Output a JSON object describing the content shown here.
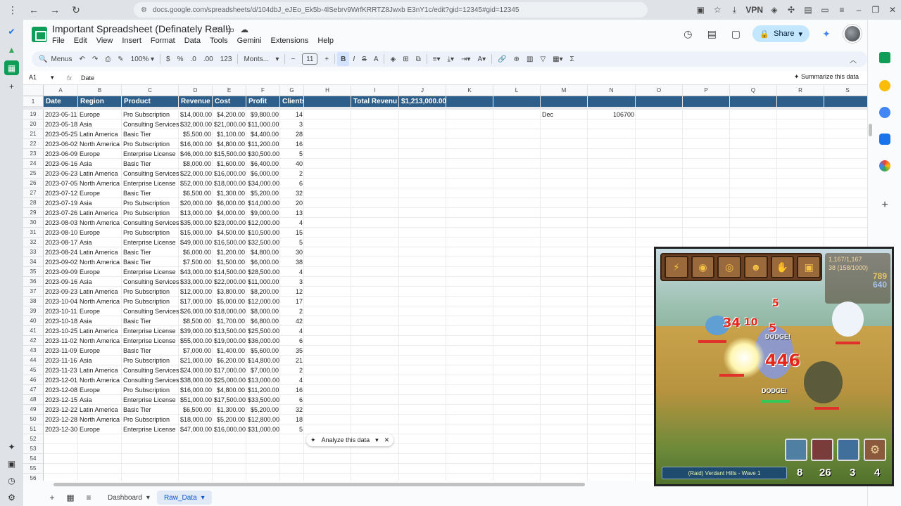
{
  "browser": {
    "url": "docs.google.com/spreadsheets/d/104dbJ_eJEo_Ek5b-4lSebrv9WrfKRRTZ8Jwxb E3nY1c/edit?gid=12345#gid=12345",
    "vpn_label": "VPN"
  },
  "doc": {
    "title": "Important Spreadsheet (Definately Real!)",
    "menus": [
      "File",
      "Edit",
      "View",
      "Insert",
      "Format",
      "Data",
      "Tools",
      "Gemini",
      "Extensions",
      "Help"
    ],
    "share_label": "Share"
  },
  "toolbar": {
    "menus_label": "Menus",
    "zoom": "100%",
    "currency": "$",
    "percent": "%",
    "dec_less": ".0",
    "dec_more": ".00",
    "number_fmt": "123",
    "font": "Monts...",
    "font_size": "11",
    "bold": "B",
    "italic": "I",
    "strike": "S",
    "text_color": "A"
  },
  "formula_bar": {
    "cell_ref": "A1",
    "fx": "fx",
    "value": "Date",
    "summarize_label": "Summarize this data"
  },
  "columns": [
    "A",
    "B",
    "C",
    "D",
    "E",
    "F",
    "G",
    "H",
    "I",
    "J",
    "K",
    "L",
    "M",
    "N",
    "O",
    "P",
    "Q",
    "R",
    "S"
  ],
  "header_row": {
    "row_number": "1",
    "cells": [
      "Date",
      "Region",
      "Product",
      "Revenue",
      "Cost",
      "Profit",
      "Clients"
    ],
    "total_label": "Total Revenu",
    "total_value": "$1,213,000.00"
  },
  "rows": [
    {
      "n": "19",
      "date": "2023-05-11",
      "region": "Europe",
      "product": "Pro Subscription",
      "revenue": "$14,000.00",
      "cost": "$4,200.00",
      "profit": "$9,800.00",
      "clients": "14",
      "m": "Dec",
      "nval": "106700"
    },
    {
      "n": "20",
      "date": "2023-05-18",
      "region": "Asia",
      "product": "Consulting Services",
      "revenue": "$32,000.00",
      "cost": "$21,000.00",
      "profit": "$11,000.00",
      "clients": "3"
    },
    {
      "n": "21",
      "date": "2023-05-25",
      "region": "Latin America",
      "product": "Basic Tier",
      "revenue": "$5,500.00",
      "cost": "$1,100.00",
      "profit": "$4,400.00",
      "clients": "28"
    },
    {
      "n": "22",
      "date": "2023-06-02",
      "region": "North America",
      "product": "Pro Subscription",
      "revenue": "$16,000.00",
      "cost": "$4,800.00",
      "profit": "$11,200.00",
      "clients": "16"
    },
    {
      "n": "23",
      "date": "2023-06-09",
      "region": "Europe",
      "product": "Enterprise License",
      "revenue": "$46,000.00",
      "cost": "$15,500.00",
      "profit": "$30,500.00",
      "clients": "5"
    },
    {
      "n": "24",
      "date": "2023-06-16",
      "region": "Asia",
      "product": "Basic Tier",
      "revenue": "$8,000.00",
      "cost": "$1,600.00",
      "profit": "$6,400.00",
      "clients": "40"
    },
    {
      "n": "25",
      "date": "2023-06-23",
      "region": "Latin America",
      "product": "Consulting Services",
      "revenue": "$22,000.00",
      "cost": "$16,000.00",
      "profit": "$6,000.00",
      "clients": "2"
    },
    {
      "n": "26",
      "date": "2023-07-05",
      "region": "North America",
      "product": "Enterprise License",
      "revenue": "$52,000.00",
      "cost": "$18,000.00",
      "profit": "$34,000.00",
      "clients": "6"
    },
    {
      "n": "27",
      "date": "2023-07-12",
      "region": "Europe",
      "product": "Basic Tier",
      "revenue": "$6,500.00",
      "cost": "$1,300.00",
      "profit": "$5,200.00",
      "clients": "32"
    },
    {
      "n": "28",
      "date": "2023-07-19",
      "region": "Asia",
      "product": "Pro Subscription",
      "revenue": "$20,000.00",
      "cost": "$6,000.00",
      "profit": "$14,000.00",
      "clients": "20"
    },
    {
      "n": "29",
      "date": "2023-07-26",
      "region": "Latin America",
      "product": "Pro Subscription",
      "revenue": "$13,000.00",
      "cost": "$4,000.00",
      "profit": "$9,000.00",
      "clients": "13"
    },
    {
      "n": "30",
      "date": "2023-08-03",
      "region": "North America",
      "product": "Consulting Services",
      "revenue": "$35,000.00",
      "cost": "$23,000.00",
      "profit": "$12,000.00",
      "clients": "4"
    },
    {
      "n": "31",
      "date": "2023-08-10",
      "region": "Europe",
      "product": "Pro Subscription",
      "revenue": "$15,000.00",
      "cost": "$4,500.00",
      "profit": "$10,500.00",
      "clients": "15"
    },
    {
      "n": "32",
      "date": "2023-08-17",
      "region": "Asia",
      "product": "Enterprise License",
      "revenue": "$49,000.00",
      "cost": "$16,500.00",
      "profit": "$32,500.00",
      "clients": "5"
    },
    {
      "n": "33",
      "date": "2023-08-24",
      "region": "Latin America",
      "product": "Basic Tier",
      "revenue": "$6,000.00",
      "cost": "$1,200.00",
      "profit": "$4,800.00",
      "clients": "30"
    },
    {
      "n": "34",
      "date": "2023-09-02",
      "region": "North America",
      "product": "Basic Tier",
      "revenue": "$7,500.00",
      "cost": "$1,500.00",
      "profit": "$6,000.00",
      "clients": "38"
    },
    {
      "n": "35",
      "date": "2023-09-09",
      "region": "Europe",
      "product": "Enterprise License",
      "revenue": "$43,000.00",
      "cost": "$14,500.00",
      "profit": "$28,500.00",
      "clients": "4"
    },
    {
      "n": "36",
      "date": "2023-09-16",
      "region": "Asia",
      "product": "Consulting Services",
      "revenue": "$33,000.00",
      "cost": "$22,000.00",
      "profit": "$11,000.00",
      "clients": "3"
    },
    {
      "n": "37",
      "date": "2023-09-23",
      "region": "Latin America",
      "product": "Pro Subscription",
      "revenue": "$12,000.00",
      "cost": "$3,800.00",
      "profit": "$8,200.00",
      "clients": "12"
    },
    {
      "n": "38",
      "date": "2023-10-04",
      "region": "North America",
      "product": "Pro Subscription",
      "revenue": "$17,000.00",
      "cost": "$5,000.00",
      "profit": "$12,000.00",
      "clients": "17"
    },
    {
      "n": "39",
      "date": "2023-10-11",
      "region": "Europe",
      "product": "Consulting Services",
      "revenue": "$26,000.00",
      "cost": "$18,000.00",
      "profit": "$8,000.00",
      "clients": "2"
    },
    {
      "n": "40",
      "date": "2023-10-18",
      "region": "Asia",
      "product": "Basic Tier",
      "revenue": "$8,500.00",
      "cost": "$1,700.00",
      "profit": "$6,800.00",
      "clients": "42"
    },
    {
      "n": "41",
      "date": "2023-10-25",
      "region": "Latin America",
      "product": "Enterprise License",
      "revenue": "$39,000.00",
      "cost": "$13,500.00",
      "profit": "$25,500.00",
      "clients": "4"
    },
    {
      "n": "42",
      "date": "2023-11-02",
      "region": "North America",
      "product": "Enterprise License",
      "revenue": "$55,000.00",
      "cost": "$19,000.00",
      "profit": "$36,000.00",
      "clients": "6"
    },
    {
      "n": "43",
      "date": "2023-11-09",
      "region": "Europe",
      "product": "Basic Tier",
      "revenue": "$7,000.00",
      "cost": "$1,400.00",
      "profit": "$5,600.00",
      "clients": "35"
    },
    {
      "n": "44",
      "date": "2023-11-16",
      "region": "Asia",
      "product": "Pro Subscription",
      "revenue": "$21,000.00",
      "cost": "$6,200.00",
      "profit": "$14,800.00",
      "clients": "21"
    },
    {
      "n": "45",
      "date": "2023-11-23",
      "region": "Latin America",
      "product": "Consulting Services",
      "revenue": "$24,000.00",
      "cost": "$17,000.00",
      "profit": "$7,000.00",
      "clients": "2"
    },
    {
      "n": "46",
      "date": "2023-12-01",
      "region": "North America",
      "product": "Consulting Services",
      "revenue": "$38,000.00",
      "cost": "$25,000.00",
      "profit": "$13,000.00",
      "clients": "4"
    },
    {
      "n": "47",
      "date": "2023-12-08",
      "region": "Europe",
      "product": "Pro Subscription",
      "revenue": "$16,000.00",
      "cost": "$4,800.00",
      "profit": "$11,200.00",
      "clients": "16"
    },
    {
      "n": "48",
      "date": "2023-12-15",
      "region": "Asia",
      "product": "Enterprise License",
      "revenue": "$51,000.00",
      "cost": "$17,500.00",
      "profit": "$33,500.00",
      "clients": "6"
    },
    {
      "n": "49",
      "date": "2023-12-22",
      "region": "Latin America",
      "product": "Basic Tier",
      "revenue": "$6,500.00",
      "cost": "$1,300.00",
      "profit": "$5,200.00",
      "clients": "32"
    },
    {
      "n": "50",
      "date": "2023-12-28",
      "region": "North America",
      "product": "Pro Subscription",
      "revenue": "$18,000.00",
      "cost": "$5,200.00",
      "profit": "$12,800.00",
      "clients": "18"
    },
    {
      "n": "51",
      "date": "2023-12-30",
      "region": "Europe",
      "product": "Enterprise License",
      "revenue": "$47,000.00",
      "cost": "$16,000.00",
      "profit": "$31,000.00",
      "clients": "5"
    }
  ],
  "empty_rows": [
    "52",
    "53",
    "54",
    "55",
    "56"
  ],
  "analyze_chip": {
    "label": "Analyze this data"
  },
  "sheet_tabs": [
    {
      "label": "Dashboard",
      "active": false
    },
    {
      "label": "Raw_Data",
      "active": true
    }
  ],
  "game": {
    "hp": "1,167/1,167",
    "level": "38 (158/1000)",
    "gold": "789",
    "gems": "640",
    "damage_numbers": [
      "34",
      "10",
      "5",
      "5",
      "446"
    ],
    "dodge_text": "DODGE!",
    "wave_label": "(Raid) Verdant Hills - Wave 1",
    "counts": [
      "8",
      "26",
      "3",
      "4"
    ],
    "colors": {
      "hp_bar": "#e0312b",
      "banner": "#1f4b6e"
    }
  },
  "colors": {
    "header_fill": "#2e5f8a",
    "accent": "#0b57d0",
    "share": "#c2e7ff"
  }
}
